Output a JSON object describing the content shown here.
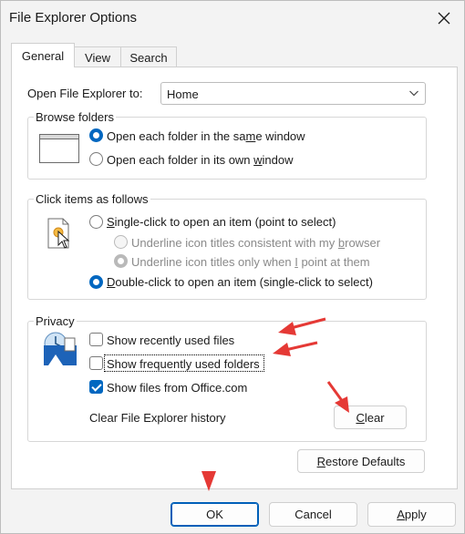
{
  "window": {
    "title": "File Explorer Options"
  },
  "tabs": [
    {
      "label": "General",
      "active": true
    },
    {
      "label": "View",
      "active": false
    },
    {
      "label": "Search",
      "active": false
    }
  ],
  "general": {
    "open_to": {
      "label": "Open File Explorer to:",
      "value": "Home"
    },
    "browse_folders": {
      "title": "Browse folders",
      "options": [
        {
          "pre": "Open each folder in the sa",
          "ul": "m",
          "post": "e window",
          "checked": true
        },
        {
          "pre": "Open each folder in its own ",
          "ul": "w",
          "post": "indow",
          "checked": false
        }
      ]
    },
    "click_items": {
      "title": "Click items as follows",
      "single": {
        "pre": "",
        "ul": "S",
        "post": "ingle-click to open an item (point to select)",
        "checked": false
      },
      "sub_options": [
        {
          "pre": "Underline icon titles consistent with my ",
          "ul": "b",
          "post": "rowser",
          "checked": false
        },
        {
          "pre": "Underline icon titles only when ",
          "ul": "I",
          "post": " point at them",
          "checked": true
        }
      ],
      "double": {
        "pre": "",
        "ul": "D",
        "post": "ouble-click to open an item (single-click to select)",
        "checked": true
      }
    },
    "privacy": {
      "title": "Privacy",
      "checks": [
        {
          "label": "Show recently used files",
          "checked": false
        },
        {
          "label": "Show frequently used folders",
          "checked": false
        },
        {
          "label": "Show files from Office.com",
          "checked": true
        }
      ],
      "clear_history_label": "Clear File Explorer history",
      "clear_button": {
        "ul": "C",
        "post": "lear"
      }
    },
    "restore_button": {
      "ul": "R",
      "post": "estore Defaults"
    }
  },
  "footer": {
    "ok": "OK",
    "cancel": "Cancel",
    "apply_ul": "A",
    "apply_post": "pply"
  },
  "annotations": {
    "arrow_color": "#e53935"
  },
  "colors": {
    "accent": "#0067c0"
  }
}
